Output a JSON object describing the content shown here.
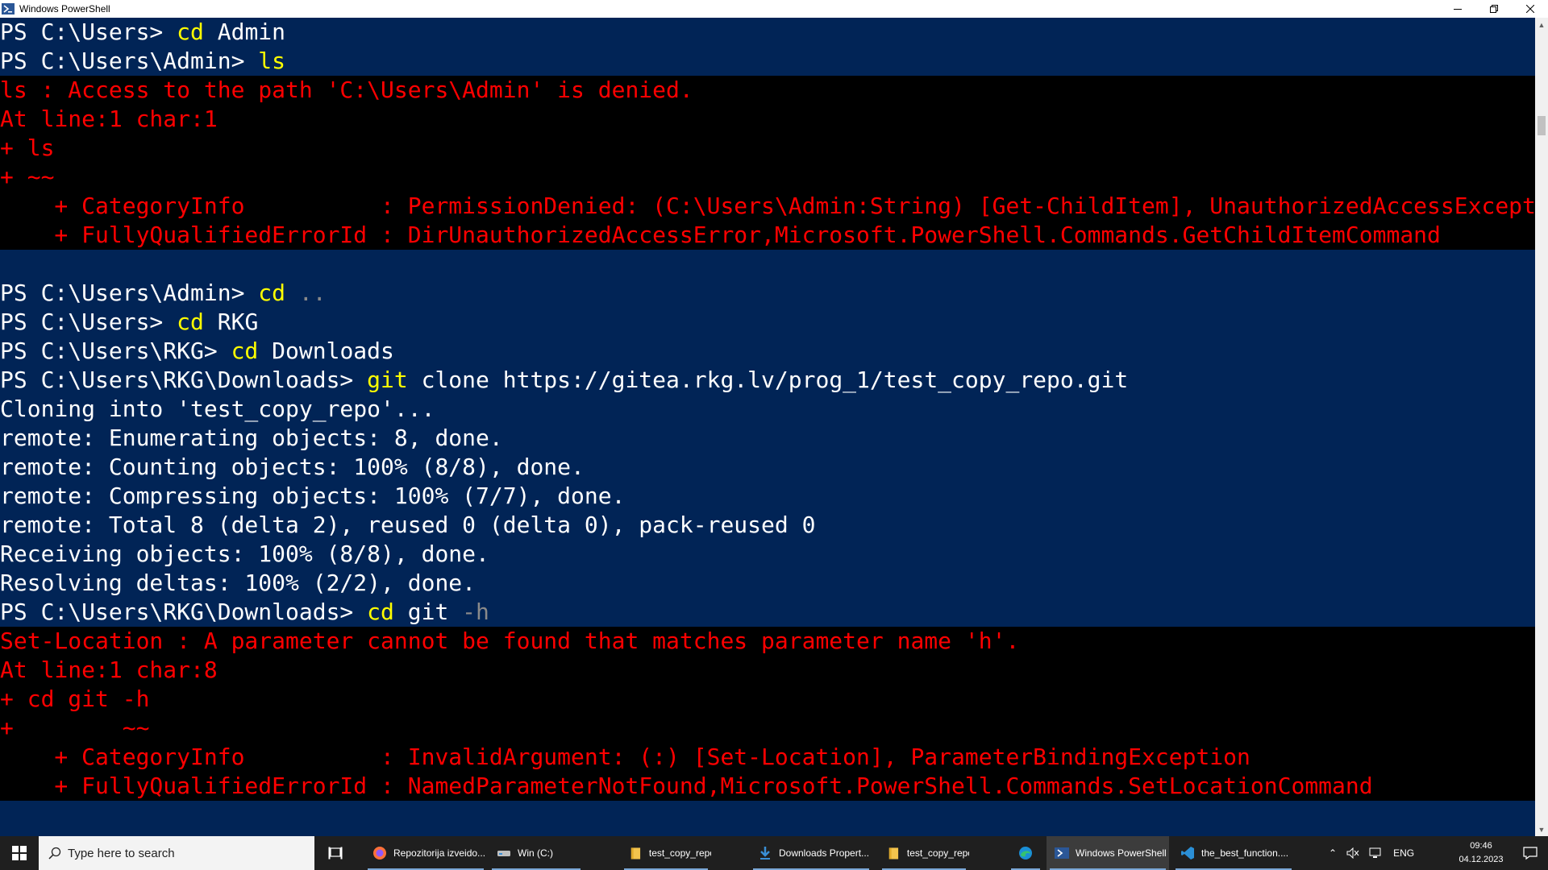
{
  "window": {
    "title": "Windows PowerShell"
  },
  "console": {
    "lines": [
      {
        "kind": "norm",
        "segs": [
          {
            "t": "PS C:\\Users> ",
            "c": "norm"
          },
          {
            "t": "cd",
            "c": "cmd"
          },
          {
            "t": " Admin",
            "c": "norm"
          }
        ]
      },
      {
        "kind": "norm",
        "segs": [
          {
            "t": "PS C:\\Users\\Admin> ",
            "c": "norm"
          },
          {
            "t": "ls",
            "c": "cmd"
          }
        ]
      },
      {
        "kind": "err",
        "segs": [
          {
            "t": "ls : Access to the path 'C:\\Users\\Admin' is denied.",
            "c": "err"
          }
        ]
      },
      {
        "kind": "err",
        "segs": [
          {
            "t": "At line:1 char:1",
            "c": "err"
          }
        ]
      },
      {
        "kind": "err",
        "segs": [
          {
            "t": "+ ls",
            "c": "err"
          }
        ]
      },
      {
        "kind": "err",
        "segs": [
          {
            "t": "+ ~~",
            "c": "err"
          }
        ]
      },
      {
        "kind": "err",
        "segs": [
          {
            "t": "    + CategoryInfo          : PermissionDenied: (C:\\Users\\Admin:String) [Get-ChildItem], UnauthorizedAccessException",
            "c": "err"
          }
        ]
      },
      {
        "kind": "err",
        "segs": [
          {
            "t": "    + FullyQualifiedErrorId : DirUnauthorizedAccessError,Microsoft.PowerShell.Commands.GetChildItemCommand",
            "c": "err"
          }
        ]
      },
      {
        "kind": "norm",
        "segs": [
          {
            "t": "",
            "c": "norm"
          }
        ]
      },
      {
        "kind": "norm",
        "segs": [
          {
            "t": "PS C:\\Users\\Admin> ",
            "c": "norm"
          },
          {
            "t": "cd",
            "c": "cmd"
          },
          {
            "t": " ..",
            "c": "dim"
          }
        ]
      },
      {
        "kind": "norm",
        "segs": [
          {
            "t": "PS C:\\Users> ",
            "c": "norm"
          },
          {
            "t": "cd",
            "c": "cmd"
          },
          {
            "t": " RKG",
            "c": "norm"
          }
        ]
      },
      {
        "kind": "norm",
        "segs": [
          {
            "t": "PS C:\\Users\\RKG> ",
            "c": "norm"
          },
          {
            "t": "cd",
            "c": "cmd"
          },
          {
            "t": " Downloads",
            "c": "norm"
          }
        ]
      },
      {
        "kind": "norm",
        "segs": [
          {
            "t": "PS C:\\Users\\RKG\\Downloads> ",
            "c": "norm"
          },
          {
            "t": "git",
            "c": "cmd"
          },
          {
            "t": " clone https://gitea.rkg.lv/prog_1/test_copy_repo.git",
            "c": "norm"
          }
        ]
      },
      {
        "kind": "norm",
        "segs": [
          {
            "t": "Cloning into 'test_copy_repo'...",
            "c": "norm"
          }
        ]
      },
      {
        "kind": "norm",
        "segs": [
          {
            "t": "remote: Enumerating objects: 8, done.",
            "c": "norm"
          }
        ]
      },
      {
        "kind": "norm",
        "segs": [
          {
            "t": "remote: Counting objects: 100% (8/8), done.",
            "c": "norm"
          }
        ]
      },
      {
        "kind": "norm",
        "segs": [
          {
            "t": "remote: Compressing objects: 100% (7/7), done.",
            "c": "norm"
          }
        ]
      },
      {
        "kind": "norm",
        "segs": [
          {
            "t": "remote: Total 8 (delta 2), reused 0 (delta 0), pack-reused 0",
            "c": "norm"
          }
        ]
      },
      {
        "kind": "norm",
        "segs": [
          {
            "t": "Receiving objects: 100% (8/8), done.",
            "c": "norm"
          }
        ]
      },
      {
        "kind": "norm",
        "segs": [
          {
            "t": "Resolving deltas: 100% (2/2), done.",
            "c": "norm"
          }
        ]
      },
      {
        "kind": "norm",
        "segs": [
          {
            "t": "PS C:\\Users\\RKG\\Downloads> ",
            "c": "norm"
          },
          {
            "t": "cd",
            "c": "cmd"
          },
          {
            "t": " git ",
            "c": "norm"
          },
          {
            "t": "-h",
            "c": "dim"
          }
        ]
      },
      {
        "kind": "err",
        "segs": [
          {
            "t": "Set-Location : A parameter cannot be found that matches parameter name 'h'.",
            "c": "err"
          }
        ]
      },
      {
        "kind": "err",
        "segs": [
          {
            "t": "At line:1 char:8",
            "c": "err"
          }
        ]
      },
      {
        "kind": "err",
        "segs": [
          {
            "t": "+ cd git -h",
            "c": "err"
          }
        ]
      },
      {
        "kind": "err",
        "segs": [
          {
            "t": "+        ~~",
            "c": "err"
          }
        ]
      },
      {
        "kind": "err",
        "segs": [
          {
            "t": "    + CategoryInfo          : InvalidArgument: (:) [Set-Location], ParameterBindingException",
            "c": "err"
          }
        ]
      },
      {
        "kind": "err",
        "segs": [
          {
            "t": "    + FullyQualifiedErrorId : NamedParameterNotFound,Microsoft.PowerShell.Commands.SetLocationCommand",
            "c": "err"
          }
        ]
      },
      {
        "kind": "norm",
        "segs": [
          {
            "t": "",
            "c": "norm"
          }
        ]
      }
    ]
  },
  "colors": {
    "console_bg": "#012456",
    "error_bg": "#000000",
    "error_fg": "#ff0000",
    "command_fg": "#ffff00",
    "text_fg": "#ffffff"
  },
  "taskbar": {
    "search_placeholder": "Type here to search",
    "apps": [
      {
        "label": "Repozitorija izveido...",
        "icon": "firefox-icon"
      },
      {
        "label": "Win (C:)",
        "icon": "drive-icon"
      },
      {
        "label": "test_copy_repo",
        "icon": "folder-icon"
      },
      {
        "label": "Downloads Propert...",
        "icon": "download-icon"
      },
      {
        "label": "test_copy_repo",
        "icon": "folder-icon"
      },
      {
        "label": "",
        "icon": "edge-icon"
      },
      {
        "label": "Windows PowerShell",
        "icon": "powershell-icon"
      },
      {
        "label": "the_best_function....",
        "icon": "vscode-icon"
      }
    ],
    "tray": {
      "language": "ENG",
      "time": "09:46",
      "date": "04.12.2023"
    }
  }
}
